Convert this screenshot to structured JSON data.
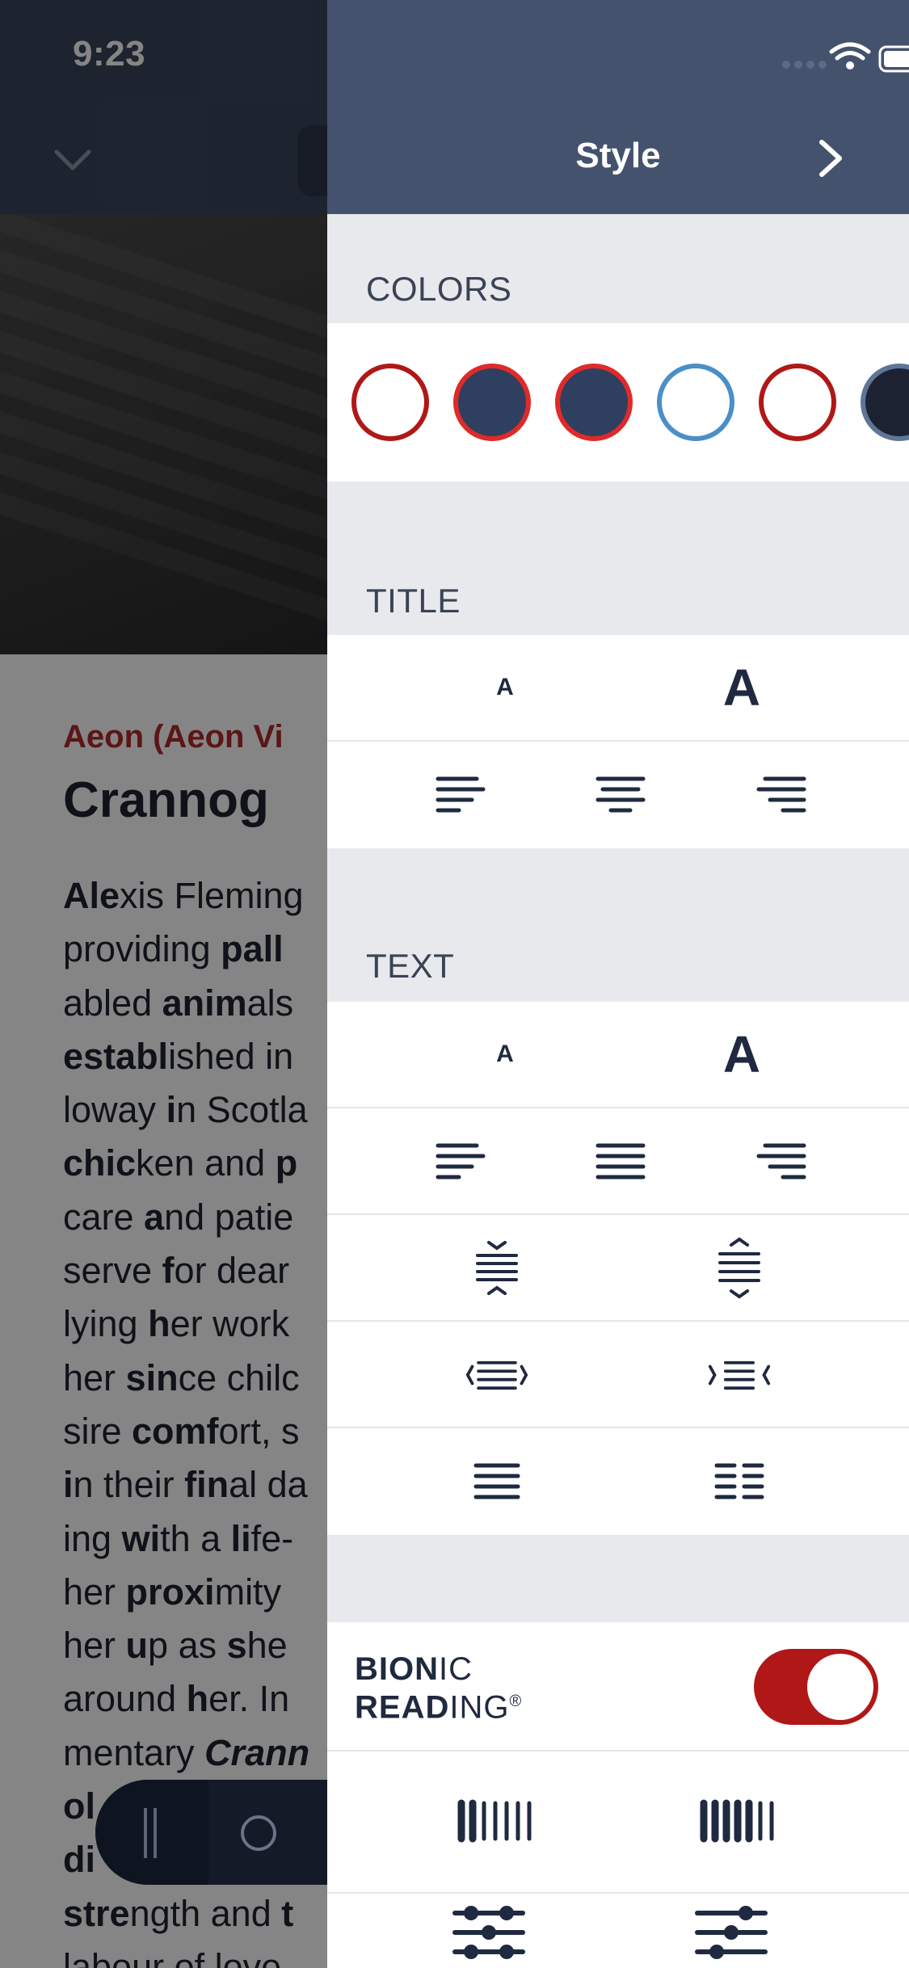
{
  "status_bar": {
    "time": "9:23"
  },
  "reader": {
    "kicker": "Aeon (Aeon Vi",
    "title": "Crannog",
    "body_lines": [
      [
        [
          "b",
          "Ale"
        ],
        [
          "t",
          "xis Fleming"
        ]
      ],
      [
        [
          "t",
          "providing "
        ],
        [
          "b",
          "pall"
        ]
      ],
      [
        [
          "t",
          "abled "
        ],
        [
          "b",
          "anim"
        ],
        [
          "t",
          "als"
        ]
      ],
      [
        [
          "b",
          "establ"
        ],
        [
          "t",
          "ished in"
        ]
      ],
      [
        [
          "t",
          "loway "
        ],
        [
          "b",
          "i"
        ],
        [
          "t",
          "n Scotla"
        ]
      ],
      [
        [
          "b",
          "chic"
        ],
        [
          "t",
          "ken and "
        ],
        [
          "b",
          "p"
        ]
      ],
      [
        [
          "t",
          "care "
        ],
        [
          "b",
          "a"
        ],
        [
          "t",
          "nd patie"
        ]
      ],
      [
        [
          "t",
          "serve "
        ],
        [
          "b",
          "f"
        ],
        [
          "t",
          "or dear"
        ]
      ],
      [
        [
          "t",
          "lying "
        ],
        [
          "b",
          "h"
        ],
        [
          "t",
          "er work"
        ]
      ],
      [
        [
          "t",
          "her "
        ],
        [
          "b",
          "sin"
        ],
        [
          "t",
          "ce chilc"
        ]
      ],
      [
        [
          "t",
          "sire "
        ],
        [
          "b",
          "comf"
        ],
        [
          "t",
          "ort, s"
        ]
      ],
      [
        [
          "b",
          "i"
        ],
        [
          "t",
          "n their "
        ],
        [
          "b",
          "fin"
        ],
        [
          "t",
          "al da"
        ]
      ],
      [
        [
          "t",
          "ing "
        ],
        [
          "b",
          "wi"
        ],
        [
          "t",
          "th a "
        ],
        [
          "b",
          "li"
        ],
        [
          "t",
          "fe-"
        ]
      ],
      [
        [
          "t",
          "her "
        ],
        [
          "b",
          "proxi"
        ],
        [
          "t",
          "mity "
        ]
      ],
      [
        [
          "t",
          "her "
        ],
        [
          "b",
          "u"
        ],
        [
          "t",
          "p as "
        ],
        [
          "b",
          "s"
        ],
        [
          "t",
          "he "
        ]
      ],
      [
        [
          "t",
          "around "
        ],
        [
          "b",
          "h"
        ],
        [
          "t",
          "er. In"
        ]
      ],
      [
        [
          "t",
          "mentary "
        ],
        [
          "i",
          "Crann"
        ]
      ],
      [
        [
          "b",
          "ol"
        ]
      ],
      [
        [
          "b",
          "di"
        ]
      ],
      [
        [
          "b",
          "stre"
        ],
        [
          "t",
          "ngth and "
        ],
        [
          "b",
          "t"
        ]
      ],
      [
        [
          "t",
          "labour of love"
        ]
      ]
    ]
  },
  "panel": {
    "title": "Style",
    "colors_label": "COLORS",
    "title_label": "TITLE",
    "text_label": "TEXT",
    "size_small_glyph": "A",
    "size_large_glyph": "A",
    "swatches": [
      {
        "fill": "#ffffff",
        "ring": "#b01818"
      },
      {
        "fill": "#2f3f5f",
        "ring": "#e02a2a"
      },
      {
        "fill": "#2f3f5f",
        "ring": "#e02a2a"
      },
      {
        "fill": "#ffffff",
        "ring": "#4a8fc7"
      },
      {
        "fill": "#ffffff",
        "ring": "#b01818"
      },
      {
        "fill": "#1c2232",
        "ring": "#5f7596"
      }
    ],
    "bionic": {
      "bold": "BION",
      "regular": "IC",
      "bold2": "READ",
      "regular2": "ING",
      "mark": "®",
      "enabled": true
    },
    "accent": "#b01818",
    "icon_color": "#1f2a40"
  }
}
